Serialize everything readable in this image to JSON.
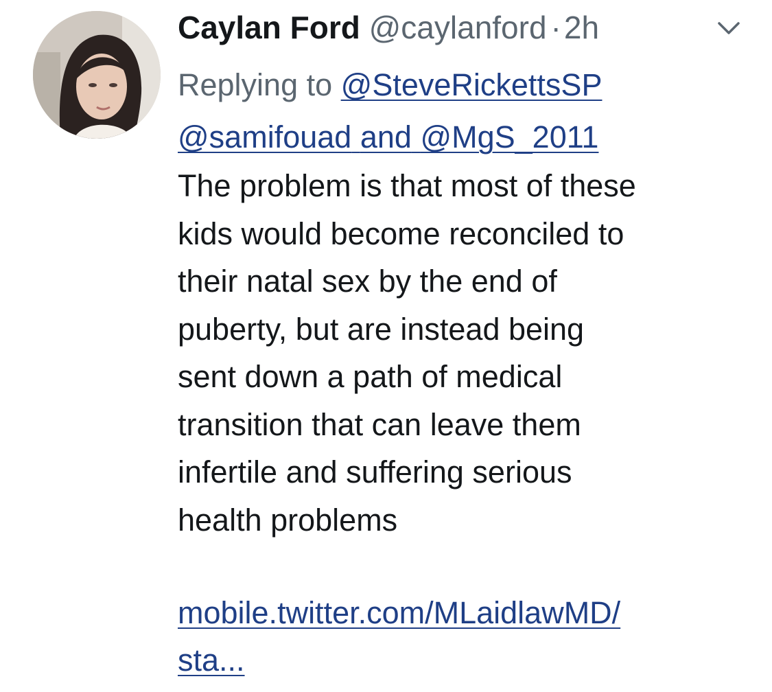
{
  "tweet": {
    "display_name": "Caylan Ford",
    "handle": "@caylanford",
    "separator": "·",
    "time": "2h",
    "reply_prefix": "Replying to",
    "reply_to": [
      "@SteveRickettsSP",
      "@samifouad",
      "@MgS_2011"
    ],
    "reply_joiner": "and",
    "text": "The problem is that most of these\nkids would become reconciled to\ntheir natal sex by the end of\npuberty, but are instead being\nsent down a path of medical\ntransition that can leave them\ninfertile and suffering serious\nhealth problems",
    "link_line1": "mobile.twitter.com/MLaidlawMD/",
    "link_line2": "sta..."
  },
  "icons": {
    "menu": "chevron-down-icon"
  },
  "colors": {
    "text": "#14171a",
    "secondary": "#5b6670",
    "link": "#1f3f86"
  }
}
